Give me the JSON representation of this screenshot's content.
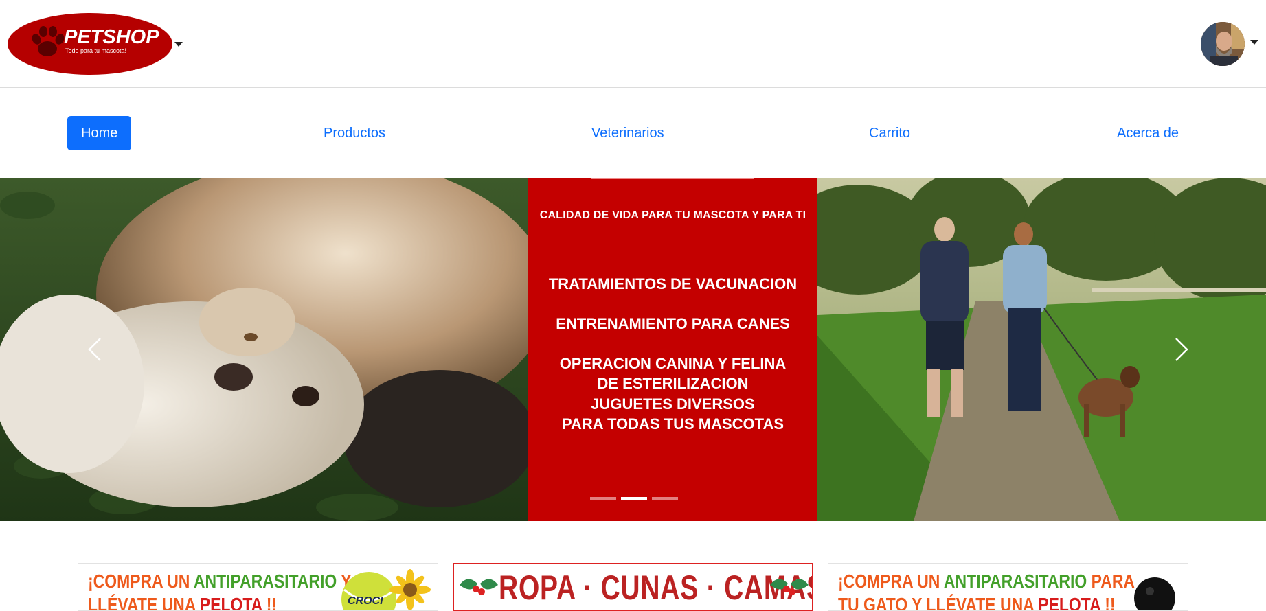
{
  "header": {
    "brand": {
      "title": "PETSHOP",
      "subtitle": "Todo para tu mascota!",
      "color": "#b50000"
    }
  },
  "nav": {
    "items": [
      {
        "label": "Home",
        "active": true
      },
      {
        "label": "Productos",
        "active": false
      },
      {
        "label": "Veterinarios",
        "active": false
      },
      {
        "label": "Carrito",
        "active": false
      },
      {
        "label": "Acerca de",
        "active": false
      }
    ],
    "accent": "#0d6efd"
  },
  "carousel": {
    "tagline": "CALIDAD DE VIDA PARA TU MASCOTA Y PARA TI",
    "services": [
      [
        "TRATAMIENTOS DE VACUNACION"
      ],
      [
        "ENTRENAMIENTO PARA CANES"
      ],
      [
        "OPERACION CANINA Y FELINA",
        "DE ESTERILIZACION"
      ],
      [
        "JUGUETES DIVERSOS",
        "PARA TODAS TUS MASCOTAS"
      ]
    ],
    "active_indicator": 2,
    "indicator_count": 3,
    "panel_color": "#c40000",
    "prev_icon": "chevron-left-icon",
    "next_icon": "chevron-right-icon"
  },
  "promos": [
    {
      "line1": [
        "¡COMPRA UN ",
        "ANTIPARASITARIO",
        " Y"
      ],
      "line2": [
        "LLÉVATE UNA ",
        "PELOTA",
        " !!"
      ],
      "brand_mark": "CROCI"
    },
    {
      "title": "ROPA · CUNAS · CAMAS"
    },
    {
      "line1": [
        "¡COMPRA UN ",
        "ANTIPARASITARIO",
        " PARA"
      ],
      "line2": [
        "TU GATO Y LLÉVATE UNA ",
        "PELOTA",
        " !!"
      ]
    }
  ]
}
